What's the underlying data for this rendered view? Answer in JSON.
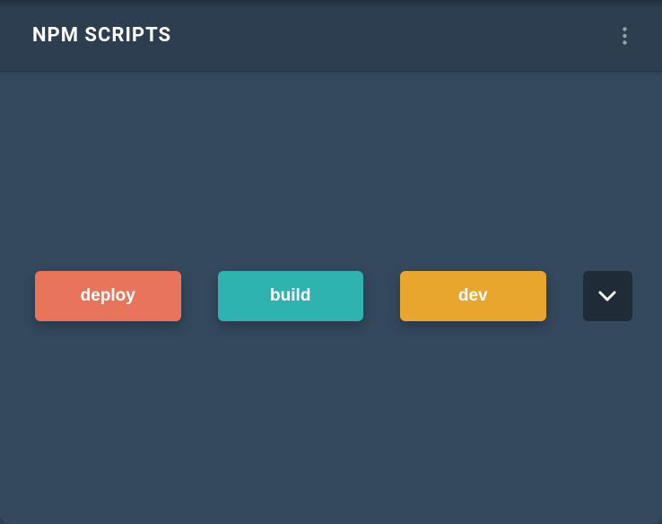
{
  "header": {
    "title": "NPM SCRIPTS"
  },
  "scripts": [
    {
      "label": "deploy",
      "color": "#e8745c",
      "name": "script-deploy"
    },
    {
      "label": "build",
      "color": "#2fb3b1",
      "name": "script-build"
    },
    {
      "label": "dev",
      "color": "#e9a62e",
      "name": "script-dev"
    }
  ],
  "icons": {
    "more": "more-vertical-icon",
    "expand": "chevron-down-icon"
  }
}
